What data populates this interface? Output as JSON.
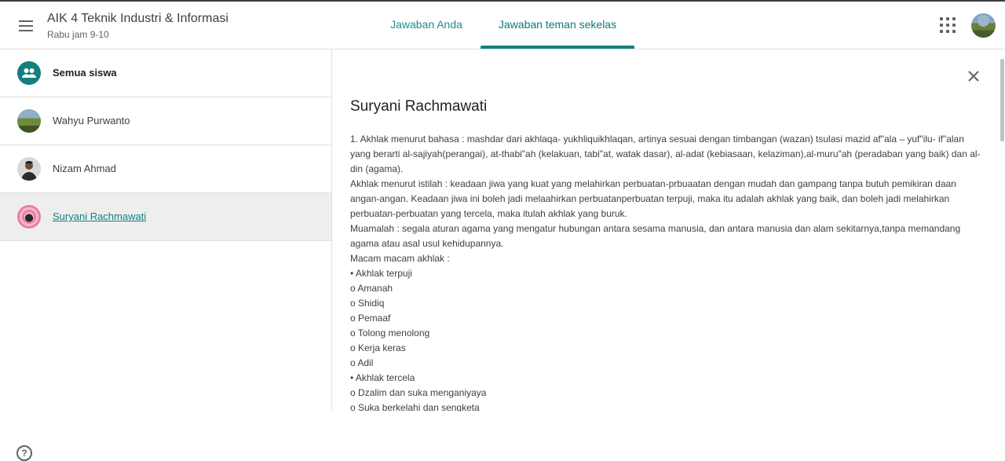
{
  "header": {
    "class_title": "AIK 4 Teknik Industri & Informasi",
    "class_schedule": "Rabu jam 9-10",
    "tabs": [
      {
        "label": "Jawaban Anda"
      },
      {
        "label": "Jawaban teman sekelas"
      }
    ],
    "active_tab": "Jawaban teman sekelas"
  },
  "sidebar": {
    "items": [
      {
        "label": "Semua siswa",
        "icon": "people-icon"
      },
      {
        "label": "Wahyu Purwanto",
        "icon": "avatar"
      },
      {
        "label": "Nizam Ahmad",
        "icon": "avatar"
      },
      {
        "label": "Suryani Rachmawati",
        "icon": "avatar",
        "selected": true
      }
    ]
  },
  "answer": {
    "student_name": "Suryani Rachmawati",
    "lines": [
      "1. Akhlak menurut bahasa : mashdar dari akhlaqa- yukhliquikhlaqan, artinya sesuai dengan timbangan (wazan) tsulasi mazid af\"ala – yuf\"ilu- if\"alan yang berarti al-sajiyah(perangai), at-thabi\"ah (kelakuan, tabi\"at, watak dasar), al-adat (kebiasaan, kelaziman),al-muru\"ah (peradaban yang baik) dan al-din (agama).",
      "Akhlak menurut istilah : keadaan jiwa yang kuat yang melahirkan perbuatan-prbuaatan dengan mudah dan gampang tanpa butuh pemikiran daan angan-angan. Keadaan jiwa ini boleh jadi melaahirkan perbuatanperbuatan terpuji, maka itu adalah akhlak yang baik, dan boleh jadi melahirkan perbuatan-perbuatan yang tercela, maka itulah akhlak yang buruk.",
      "Muamalah : segala aturan agama yang mengatur hubungan antara sesama manusia, dan antara manusia dan alam sekitarnya,tanpa memandang agama atau asal usul kehidupannya.",
      " Macam macam akhlak :",
      "• Akhlak terpuji",
      "o Amanah",
      "o Shidiq",
      "o Pemaaf",
      "o Tolong menolong",
      "o Kerja keras",
      "o Adil",
      "• Akhlak tercela",
      "o Dzalim dan suka menganiyaya",
      "o Suka berkelahi dan sengketa"
    ]
  },
  "colors": {
    "accent": "#137f7f",
    "selected_row": "#eeeeee"
  }
}
